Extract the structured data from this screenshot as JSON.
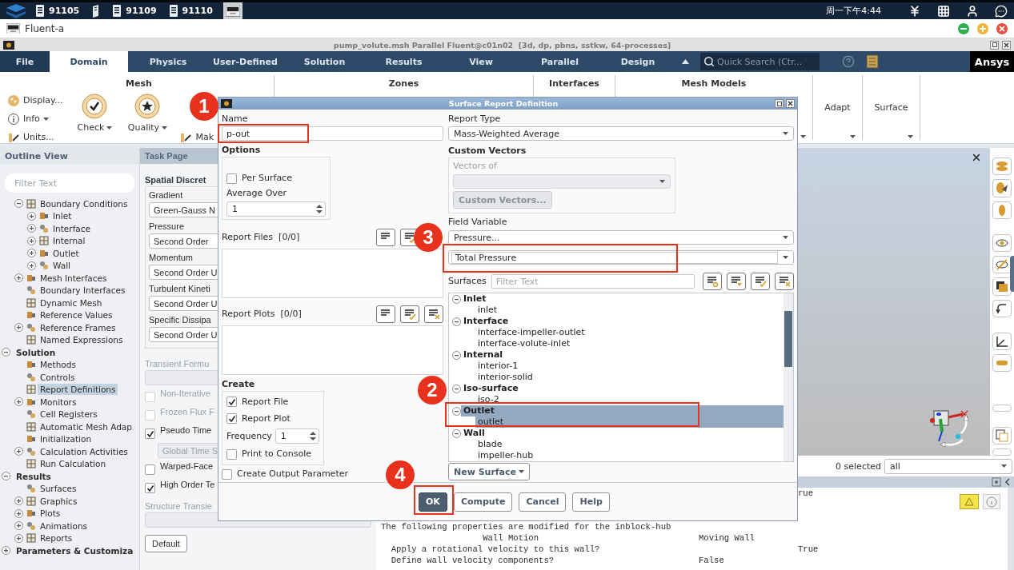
{
  "taskbar": {
    "tasks": [
      {
        "kind": "labeled",
        "label": "91105",
        "selected": false
      },
      {
        "kind": "book",
        "selected": false
      },
      {
        "kind": "labeled",
        "label": "91109",
        "selected": false
      },
      {
        "kind": "labeled",
        "label": "91110",
        "selected": false
      },
      {
        "kind": "app",
        "selected": true
      }
    ],
    "clock": "周一下午4:44"
  },
  "app_window": {
    "title": "Fluent-a"
  },
  "window_title": "pump_volute.msh Parallel Fluent@c01n02  [3d, dp, pbns, sstkw, 64-processes]",
  "ribbon": {
    "tabs": [
      {
        "label": "File",
        "selected": false
      },
      {
        "label": "Domain",
        "selected": true
      },
      {
        "label": "Physics",
        "selected": false
      },
      {
        "label": "User-Defined",
        "selected": false
      },
      {
        "label": "Solution",
        "selected": false
      },
      {
        "label": "Results",
        "selected": false
      },
      {
        "label": "View",
        "selected": false
      },
      {
        "label": "Parallel",
        "selected": false
      },
      {
        "label": "Design",
        "selected": false
      }
    ],
    "search": {
      "placeholder": "Quick Search (Ctr..."
    },
    "brand": "Ansys",
    "groups": [
      {
        "kind": "titled",
        "title": "Mesh",
        "items": [
          {
            "kind": "small",
            "label": "Display...",
            "dropdown": false
          },
          {
            "kind": "small",
            "label": "Info",
            "dropdown": true
          },
          {
            "kind": "small",
            "label": "Units...",
            "dropdown": false
          },
          {
            "kind": "large",
            "label": "Check",
            "dropdown": true
          },
          {
            "kind": "large",
            "label": "Quality",
            "dropdown": true
          },
          {
            "kind": "small",
            "label": "Mak",
            "dropdown": false
          }
        ]
      },
      {
        "kind": "titled",
        "title": "Zones"
      },
      {
        "kind": "titled",
        "title": "Interfaces"
      },
      {
        "kind": "titled",
        "title": "Mesh Models"
      },
      {
        "kind": "compact",
        "title": "Adapt"
      },
      {
        "kind": "compact",
        "title": "Surface"
      }
    ]
  },
  "outline": {
    "title": "Outline View",
    "filter_placeholder": "Filter Text",
    "branch": [
      {
        "label": "Boundary Conditions",
        "expanded": true,
        "selected": false,
        "children": [
          {
            "label": "Inlet",
            "expanded": false,
            "selected": false
          },
          {
            "label": "Interface",
            "expanded": false,
            "selected": false
          },
          {
            "label": "Internal",
            "expanded": false,
            "selected": false
          },
          {
            "label": "Outlet",
            "expanded": false,
            "selected": false
          },
          {
            "label": "Wall",
            "expanded": false,
            "selected": false
          }
        ]
      },
      {
        "label": "Mesh Interfaces",
        "expanded": false,
        "selected": false
      },
      {
        "label": "Boundary Interfaces",
        "selected": false
      },
      {
        "label": "Dynamic Mesh",
        "selected": false
      },
      {
        "label": "Reference Values",
        "selected": false
      },
      {
        "label": "Reference Frames",
        "expanded": false,
        "selected": false
      },
      {
        "label": "Named Expressions",
        "selected": false
      }
    ],
    "tree": [
      {
        "label": "Solution",
        "expanded": true,
        "selected": false,
        "children": [
          {
            "label": "Methods",
            "selected": false
          },
          {
            "label": "Controls",
            "selected": false
          },
          {
            "label": "Report Definitions",
            "selected": true
          },
          {
            "label": "Monitors",
            "expanded": false,
            "selected": false
          },
          {
            "label": "Cell Registers",
            "selected": false
          },
          {
            "label": "Automatic Mesh Adap",
            "selected": false
          },
          {
            "label": "Initialization",
            "selected": false
          },
          {
            "label": "Calculation Activities",
            "expanded": false,
            "selected": false
          },
          {
            "label": "Run Calculation",
            "selected": false
          }
        ]
      },
      {
        "label": "Results",
        "expanded": true,
        "selected": false,
        "children": [
          {
            "label": "Surfaces",
            "selected": false
          },
          {
            "label": "Graphics",
            "expanded": false,
            "selected": false
          },
          {
            "label": "Plots",
            "expanded": false,
            "selected": false
          },
          {
            "label": "Animations",
            "expanded": false,
            "selected": false
          },
          {
            "label": "Reports",
            "expanded": false,
            "selected": false
          }
        ]
      },
      {
        "label": "Parameters & Customiza",
        "expanded": false,
        "selected": false
      }
    ]
  },
  "task_page": {
    "title": "Task Page",
    "section": {
      "title": "Spatial Discret",
      "fields": [
        {
          "label": "Gradient",
          "value": "Green-Gauss N"
        },
        {
          "label": "Pressure",
          "value": "Second Order"
        },
        {
          "label": "Momentum",
          "value": "Second Order U"
        },
        {
          "label": "Turbulent Kineti",
          "value": "Second Order U"
        },
        {
          "label": "Specific Dissipa",
          "value": "Second Order U"
        }
      ]
    },
    "rows": [
      {
        "kind": "label",
        "label": "Transient Formu",
        "disabled": true
      },
      {
        "kind": "dropdown",
        "disabled": true
      },
      {
        "kind": "checkbox",
        "label": "Non-Iterative",
        "checked": false,
        "disabled": true
      },
      {
        "kind": "checkbox",
        "label": "Frozen Flux F",
        "checked": false,
        "disabled": true
      },
      {
        "kind": "checkbox",
        "label": "Pseudo Time",
        "checked": true,
        "disabled": false
      },
      {
        "kind": "dropdown",
        "value": "Global Time S",
        "disabled": true
      },
      {
        "kind": "checkbox",
        "label": "Warped-Face",
        "checked": false,
        "disabled": false
      },
      {
        "kind": "checkbox",
        "label": "High Order Te",
        "checked": true,
        "disabled": false
      },
      {
        "kind": "label",
        "label": "Structure Transie",
        "disabled": true
      },
      {
        "kind": "dropdown",
        "disabled": true
      },
      {
        "kind": "button",
        "label": "Default",
        "disabled": false
      }
    ]
  },
  "graphics": {
    "selection_count": "0 selected",
    "selection_filter": "all"
  },
  "console": {
    "lines": [
      {
        "col3": "rue"
      },
      {
        "col1": "The following properties are modified for the inblock-hub"
      },
      {
        "col1": "                    Wall Motion",
        "col2": "Moving Wall"
      },
      {
        "col1": "  Apply a rotational velocity to this wall?",
        "col3": "True"
      },
      {
        "col1": "  Define wall velocity components?",
        "col2": "False"
      }
    ]
  },
  "dialog": {
    "title": "Surface Report Definition",
    "name": {
      "label": "Name",
      "value": "p-out"
    },
    "options": {
      "title": "Options",
      "per_surface": {
        "label": "Per Surface",
        "checked": false
      },
      "average_over": {
        "label": "Average Over",
        "value": "1"
      }
    },
    "report_files": {
      "label": "Report Files  [0/0]"
    },
    "report_plots": {
      "label": "Report Plots  [0/0]"
    },
    "create": {
      "title": "Create",
      "checks": [
        {
          "label": "Report File",
          "checked": true
        },
        {
          "label": "Report Plot",
          "checked": true
        }
      ],
      "frequency": {
        "label": "Frequency",
        "value": "1"
      },
      "print_to_console": {
        "label": "Print to Console",
        "checked": false
      }
    },
    "create_output_parameter": {
      "label": "Create Output Parameter",
      "checked": false
    },
    "report_type": {
      "label": "Report Type",
      "value": "Mass-Weighted Average"
    },
    "custom_vectors": {
      "title": "Custom Vectors",
      "vectors_of": "Vectors of",
      "button": "Custom Vectors...",
      "disabled": true
    },
    "field_variable": {
      "label": "Field Variable",
      "category": "Pressure...",
      "value": "Total Pressure"
    },
    "surfaces": {
      "label": "Surfaces",
      "filter_placeholder": "Filter Text",
      "groups": [
        {
          "label": "Inlet",
          "expanded": true,
          "selected": false,
          "children": [
            {
              "label": "inlet",
              "selected": false
            }
          ]
        },
        {
          "label": "Interface",
          "expanded": true,
          "selected": false,
          "children": [
            {
              "label": "interface-impeller-outlet",
              "selected": false
            },
            {
              "label": "interface-volute-inlet",
              "selected": false
            }
          ]
        },
        {
          "label": "Internal",
          "expanded": true,
          "selected": false,
          "children": [
            {
              "label": "interior-1",
              "selected": false
            },
            {
              "label": "interior-solid",
              "selected": false
            }
          ]
        },
        {
          "label": "Iso-surface",
          "expanded": true,
          "selected": false,
          "children": [
            {
              "label": "iso-2",
              "selected": false
            }
          ]
        },
        {
          "label": "Outlet",
          "expanded": true,
          "selected": true,
          "children": [
            {
              "label": "outlet",
              "selected": true
            }
          ]
        },
        {
          "label": "Wall",
          "expanded": true,
          "selected": false,
          "children": [
            {
              "label": "blade",
              "selected": false
            },
            {
              "label": "impeller-hub",
              "selected": false
            }
          ]
        }
      ]
    },
    "new_surface": "New Surface",
    "buttons": [
      {
        "label": "OK",
        "kind": "primary"
      },
      {
        "label": "Compute",
        "kind": "normal"
      },
      {
        "label": "Cancel",
        "kind": "normal"
      },
      {
        "label": "Help",
        "kind": "normal"
      }
    ]
  },
  "annotations": [
    {
      "label": "1"
    },
    {
      "label": "2"
    },
    {
      "label": "3"
    },
    {
      "label": "4"
    }
  ]
}
